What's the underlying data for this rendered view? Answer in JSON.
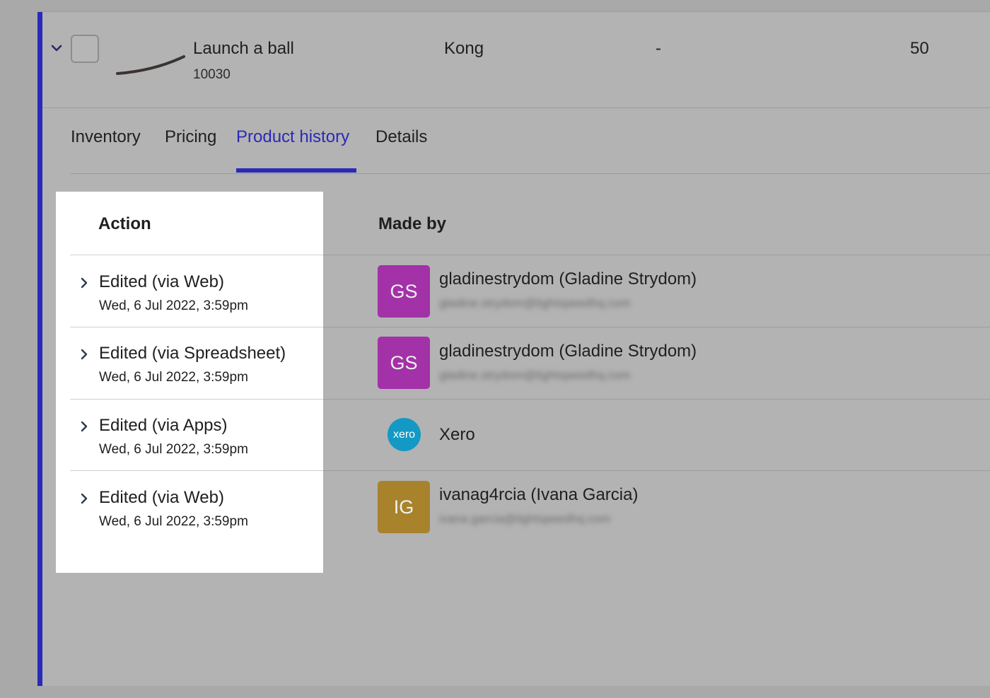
{
  "product": {
    "name": "Launch a ball",
    "sku": "10030",
    "brand": "Kong",
    "supplier": "-",
    "quantity": "50"
  },
  "tabs": [
    {
      "label": "Inventory",
      "active": false
    },
    {
      "label": "Pricing",
      "active": false
    },
    {
      "label": "Product history",
      "active": true
    },
    {
      "label": "Details",
      "active": false
    }
  ],
  "history": {
    "columns": {
      "action": "Action",
      "made_by": "Made by"
    },
    "rows": [
      {
        "action": "Edited (via Web)",
        "date": "Wed, 6 Jul 2022, 3:59pm",
        "avatar": "GS",
        "avatar_color": "#a331a8",
        "user": "gladinestrydom (Gladine Strydom)",
        "email": "gladine.strydom@lightspeedhq.com"
      },
      {
        "action": "Edited (via Spreadsheet)",
        "date": "Wed, 6 Jul 2022, 3:59pm",
        "avatar": "GS",
        "avatar_color": "#a331a8",
        "user": "gladinestrydom (Gladine Strydom)",
        "email": "gladine.strydom@lightspeedhq.com"
      },
      {
        "action": "Edited (via Apps)",
        "date": "Wed, 6 Jul 2022, 3:59pm",
        "avatar": "xero",
        "avatar_color": "#1399c4",
        "user": "Xero",
        "email": ""
      },
      {
        "action": "Edited (via Web)",
        "date": "Wed, 6 Jul 2022, 3:59pm",
        "avatar": "IG",
        "avatar_color": "#a8832c",
        "user": "ivanag4rcia (Ivana Garcia)",
        "email": "ivana.garcia@lightspeedhq.com"
      }
    ]
  },
  "colors": {
    "accent": "#2a2ab8",
    "overlay_bg": "#b3b3b3",
    "highlight_bg": "#ffffff"
  }
}
